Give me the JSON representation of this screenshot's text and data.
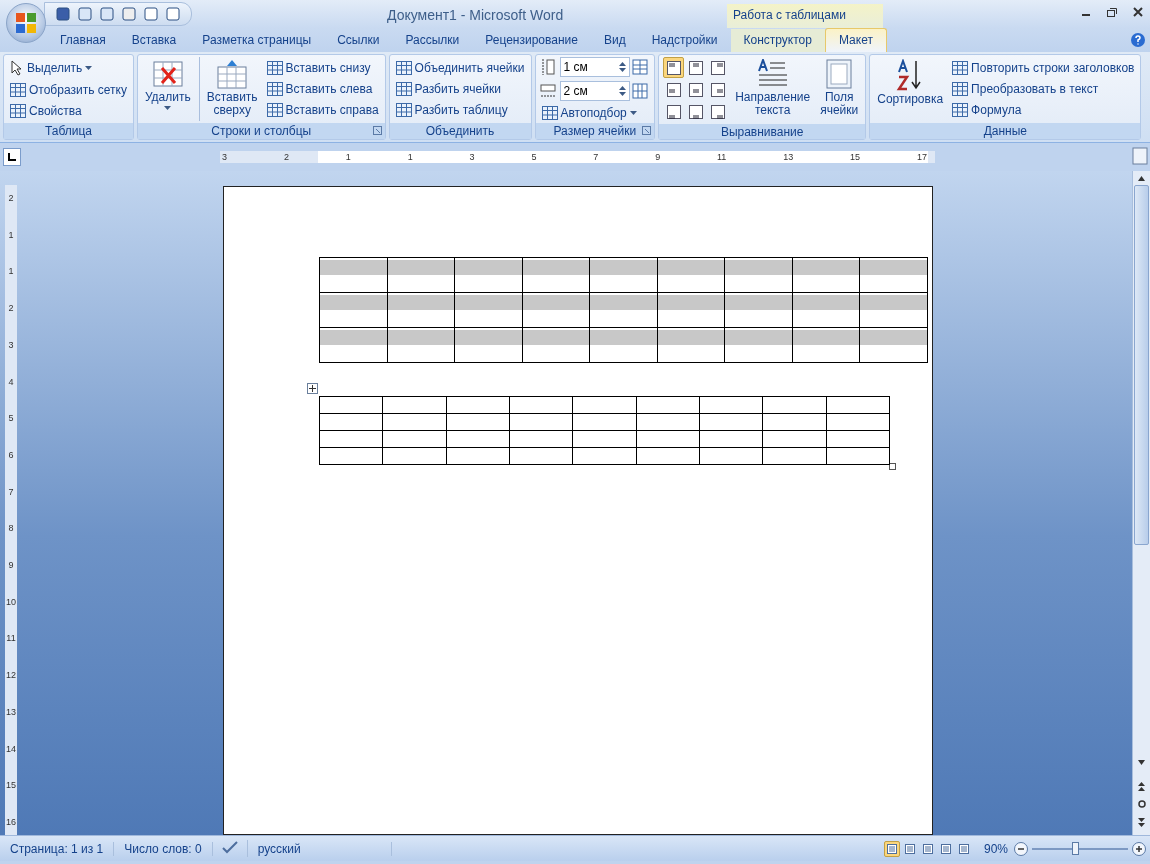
{
  "window": {
    "title": "Документ1 - Microsoft Word",
    "context_header": "Работа с таблицами"
  },
  "tabs": [
    {
      "label": "Главная",
      "selected": false,
      "context": false
    },
    {
      "label": "Вставка",
      "selected": false,
      "context": false
    },
    {
      "label": "Разметка страницы",
      "selected": false,
      "context": false
    },
    {
      "label": "Ссылки",
      "selected": false,
      "context": false
    },
    {
      "label": "Рассылки",
      "selected": false,
      "context": false
    },
    {
      "label": "Рецензирование",
      "selected": false,
      "context": false
    },
    {
      "label": "Вид",
      "selected": false,
      "context": false
    },
    {
      "label": "Надстройки",
      "selected": false,
      "context": false
    },
    {
      "label": "Конструктор",
      "selected": false,
      "context": true
    },
    {
      "label": "Макет",
      "selected": true,
      "context": true
    }
  ],
  "ribbon_groups": [
    {
      "label": "Таблица",
      "launcher": false,
      "columns": [
        {
          "kind": "stack",
          "items": [
            {
              "label": "Выделить",
              "dropdown": true
            },
            {
              "label": "Отобразить сетку",
              "dropdown": false
            },
            {
              "label": "Свойства",
              "dropdown": false
            }
          ]
        }
      ]
    },
    {
      "label": "Строки и столбцы",
      "launcher": true,
      "columns": [
        {
          "kind": "large",
          "label": "Удалить",
          "dropdown": true,
          "separator": true
        },
        {
          "kind": "large",
          "label": "Вставить\nсверху",
          "dropdown": false,
          "separator": false
        },
        {
          "kind": "stack",
          "items": [
            {
              "label": "Вставить снизу",
              "dropdown": false
            },
            {
              "label": "Вставить слева",
              "dropdown": false
            },
            {
              "label": "Вставить справа",
              "dropdown": false
            }
          ]
        }
      ]
    },
    {
      "label": "Объединить",
      "launcher": false,
      "columns": [
        {
          "kind": "stack",
          "items": [
            {
              "label": "Объединить ячейки",
              "dropdown": false
            },
            {
              "label": "Разбить ячейки",
              "dropdown": false
            },
            {
              "label": "Разбить таблицу",
              "dropdown": false
            }
          ]
        }
      ]
    },
    {
      "label": "Размер ячейки",
      "launcher": true,
      "columns": [
        {
          "kind": "size",
          "fields": [
            {
              "value": "1 см"
            },
            {
              "value": "2 см"
            }
          ],
          "autofit": {
            "label": "Автоподбор",
            "dropdown": true
          }
        }
      ]
    },
    {
      "label": "Выравнивание",
      "launcher": false,
      "columns": [
        {
          "kind": "align",
          "cells": [
            {
              "selected": true
            },
            {
              "selected": false
            },
            {
              "selected": false
            },
            {
              "selected": false
            },
            {
              "selected": false
            },
            {
              "selected": false
            },
            {
              "selected": false
            },
            {
              "selected": false
            },
            {
              "selected": false
            }
          ]
        },
        {
          "kind": "large",
          "label": "Направление\nтекста",
          "dropdown": false,
          "separator": false
        },
        {
          "kind": "large",
          "label": "Поля\nячейки",
          "dropdown": false,
          "separator": false
        }
      ]
    },
    {
      "label": "Данные",
      "launcher": false,
      "columns": [
        {
          "kind": "large",
          "label": "Сортировка",
          "dropdown": false,
          "separator": false
        },
        {
          "kind": "stack",
          "items": [
            {
              "label": "Повторить строки заголовков",
              "dropdown": false
            },
            {
              "label": "Преобразовать в текст",
              "dropdown": false
            },
            {
              "label": "Формула",
              "dropdown": false
            }
          ]
        }
      ]
    }
  ],
  "ruler": {
    "labels": [
      "3",
      "2",
      "1",
      "1",
      "3",
      "5",
      "7",
      "9",
      "11",
      "13",
      "15",
      "17"
    ]
  },
  "vertical_ruler": {
    "labels": [
      "2",
      "1",
      "1",
      "2",
      "3",
      "4",
      "5",
      "6",
      "7",
      "8",
      "9",
      "10",
      "11",
      "12",
      "13",
      "14",
      "15",
      "16"
    ]
  },
  "tables": [
    {
      "kind": "tall",
      "rows": [
        {
          "cells": [
            {
              "shaded": true
            },
            {
              "shaded": true
            },
            {
              "shaded": true
            },
            {
              "shaded": true
            },
            {
              "shaded": true
            },
            {
              "shaded": true
            },
            {
              "shaded": true
            },
            {
              "shaded": true
            },
            {
              "shaded": true
            }
          ]
        },
        {
          "cells": [
            {
              "shaded": true
            },
            {
              "shaded": true
            },
            {
              "shaded": true
            },
            {
              "shaded": true
            },
            {
              "shaded": true
            },
            {
              "shaded": true
            },
            {
              "shaded": true
            },
            {
              "shaded": true
            },
            {
              "shaded": true
            }
          ]
        },
        {
          "cells": [
            {
              "shaded": true
            },
            {
              "shaded": true
            },
            {
              "shaded": true
            },
            {
              "shaded": true
            },
            {
              "shaded": true
            },
            {
              "shaded": true
            },
            {
              "shaded": true
            },
            {
              "shaded": true
            },
            {
              "shaded": true
            }
          ]
        }
      ]
    },
    {
      "kind": "short",
      "rows": [
        {
          "cells": [
            {
              "shaded": false
            },
            {
              "shaded": false
            },
            {
              "shaded": false
            },
            {
              "shaded": false
            },
            {
              "shaded": false
            },
            {
              "shaded": false
            },
            {
              "shaded": false
            },
            {
              "shaded": false
            },
            {
              "shaded": false
            }
          ]
        },
        {
          "cells": [
            {
              "shaded": false
            },
            {
              "shaded": false
            },
            {
              "shaded": false
            },
            {
              "shaded": false
            },
            {
              "shaded": false
            },
            {
              "shaded": false
            },
            {
              "shaded": false
            },
            {
              "shaded": false
            },
            {
              "shaded": false
            }
          ]
        },
        {
          "cells": [
            {
              "shaded": false
            },
            {
              "shaded": false
            },
            {
              "shaded": false
            },
            {
              "shaded": false
            },
            {
              "shaded": false
            },
            {
              "shaded": false
            },
            {
              "shaded": false
            },
            {
              "shaded": false
            },
            {
              "shaded": false
            }
          ]
        },
        {
          "cells": [
            {
              "shaded": false
            },
            {
              "shaded": false
            },
            {
              "shaded": false
            },
            {
              "shaded": false
            },
            {
              "shaded": false
            },
            {
              "shaded": false
            },
            {
              "shaded": false
            },
            {
              "shaded": false
            },
            {
              "shaded": false
            }
          ]
        }
      ]
    }
  ],
  "status_bar": {
    "items": [
      "Страница: 1 из 1",
      "Число слов: 0",
      "русский"
    ],
    "views": [
      {
        "selected": true
      },
      {
        "selected": false
      },
      {
        "selected": false
      },
      {
        "selected": false
      },
      {
        "selected": false
      }
    ],
    "zoom": "90%",
    "zoom_slider": {
      "level": 0.45
    }
  }
}
